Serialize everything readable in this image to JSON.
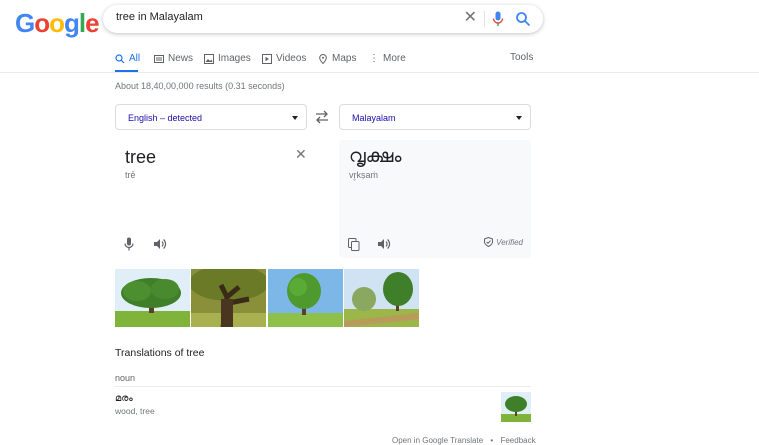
{
  "logo": {
    "letters": [
      "G",
      "o",
      "o",
      "g",
      "l",
      "e"
    ],
    "colors": [
      "#4285F4",
      "#EA4335",
      "#FBBC05",
      "#4285F4",
      "#34A853",
      "#EA4335"
    ]
  },
  "search": {
    "query": "tree in Malayalam"
  },
  "tabs": [
    {
      "label": "All",
      "icon": "search-icon"
    },
    {
      "label": "News",
      "icon": "news-icon"
    },
    {
      "label": "Images",
      "icon": "image-icon"
    },
    {
      "label": "Videos",
      "icon": "video-icon"
    },
    {
      "label": "Maps",
      "icon": "map-pin-icon"
    },
    {
      "label": "More",
      "icon": "more-vert-icon"
    }
  ],
  "tools_label": "Tools",
  "result_stats": "About 18,40,00,000 results (0.31 seconds)",
  "translate": {
    "source_language": "English – detected",
    "target_language": "Malayalam",
    "source_text": "tree",
    "source_transliteration": "trē",
    "target_text": "വൃക്ഷം",
    "target_transliteration": "vr̥kṣaṁ",
    "verified_label": "Verified"
  },
  "translations_title": "Translations of tree",
  "part_of_speech": "noun",
  "entry": {
    "word": "മരം",
    "synonyms": "wood, tree"
  },
  "footer": {
    "open_label": "Open in Google Translate",
    "dot": "•",
    "feedback_label": "Feedback"
  },
  "colors": {
    "accent": "#1a73e8",
    "link": "#1a0dab"
  }
}
